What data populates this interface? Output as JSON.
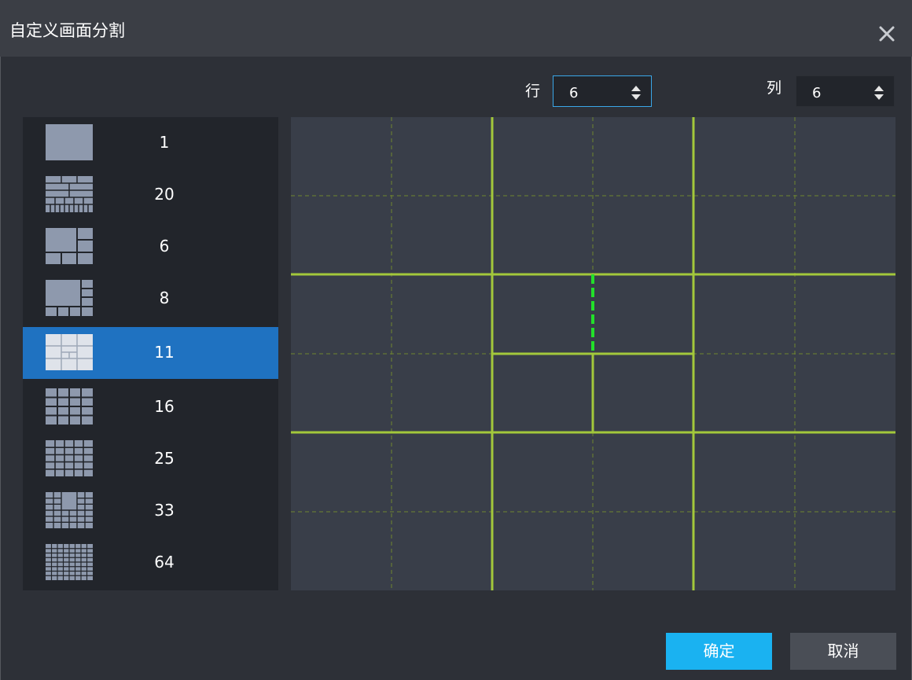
{
  "window": {
    "title": "自定义画面分割"
  },
  "controls": {
    "rows": {
      "label": "行",
      "value": "6"
    },
    "cols": {
      "label": "列",
      "value": "6"
    }
  },
  "layouts": [
    {
      "count": "1",
      "thumb": "layout-1-icon",
      "selected": false
    },
    {
      "count": "20",
      "thumb": "layout-20-icon",
      "selected": false
    },
    {
      "count": "6",
      "thumb": "layout-6-icon",
      "selected": false
    },
    {
      "count": "8",
      "thumb": "layout-8-icon",
      "selected": false
    },
    {
      "count": "11",
      "thumb": "layout-11-icon",
      "selected": true
    },
    {
      "count": "16",
      "thumb": "layout-16-icon",
      "selected": false
    },
    {
      "count": "25",
      "thumb": "layout-25-icon",
      "selected": false
    },
    {
      "count": "33",
      "thumb": "layout-33-icon",
      "selected": false
    },
    {
      "count": "64",
      "thumb": "layout-64-icon",
      "selected": false
    }
  ],
  "grid": {
    "rows": 6,
    "cols": 6
  },
  "buttons": {
    "ok": "确定",
    "cancel": "取消"
  },
  "colors": {
    "selection": "#1f72c1",
    "grid_line": "#a3c83b",
    "guide_line": "#6f8530",
    "active_split": "#22e02a",
    "primary_button": "#1ab2f1"
  }
}
